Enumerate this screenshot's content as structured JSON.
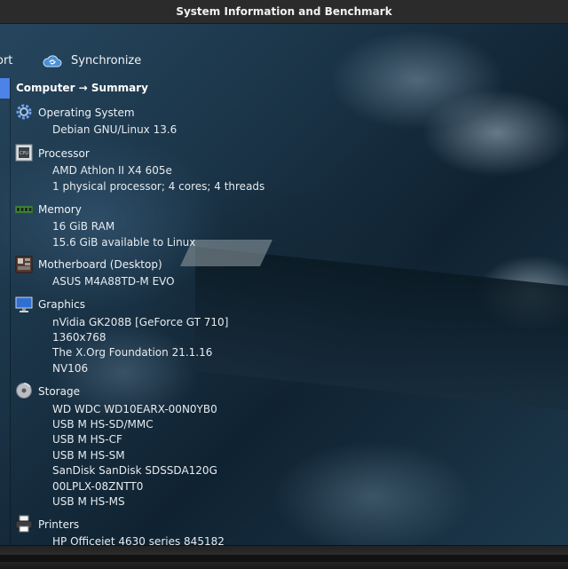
{
  "window": {
    "title": "System Information and Benchmark"
  },
  "toolbar": {
    "report_label": "ort",
    "sync_label": "Synchronize",
    "sync_icon": "cloud-sync-icon"
  },
  "breadcrumb": "Computer → Summary",
  "sections": {
    "os": {
      "icon": "gear-icon",
      "title": "Operating System",
      "lines": [
        "Debian GNU/Linux 13.6"
      ]
    },
    "processor": {
      "icon": "cpu-icon",
      "title": "Processor",
      "lines": [
        "AMD Athlon II X4 605e",
        "1 physical processor; 4 cores; 4 threads"
      ]
    },
    "memory": {
      "icon": "memory-icon",
      "title": "Memory",
      "lines": [
        "16 GiB RAM",
        "15.6 GiB available to Linux"
      ]
    },
    "motherboard": {
      "icon": "motherboard-icon",
      "title": "Motherboard (Desktop)",
      "lines": [
        "ASUS M4A88TD-M EVO"
      ]
    },
    "graphics": {
      "icon": "monitor-icon",
      "title": "Graphics",
      "lines": [
        "nVidia GK208B [GeForce GT 710]",
        "1360x768",
        "The X.Org Foundation 21.1.16",
        "NV106"
      ]
    },
    "storage": {
      "icon": "disk-icon",
      "title": "Storage",
      "lines": [
        "WD WDC WD10EARX-00N0YB0",
        "USB M HS-SD/MMC",
        "USB M HS-CF",
        "USB M HS-SM",
        "SanDisk SanDisk SDSSDA120G",
        "00LPLX-08ZNTT0",
        "USB M HS-MS"
      ]
    },
    "printers": {
      "icon": "printer-icon",
      "title": "Printers",
      "lines": [
        "HP  Officejet  4630  series  845182"
      ]
    }
  },
  "colors": {
    "accent": "#4d82e8",
    "titlebar": "#2b2b2b"
  }
}
